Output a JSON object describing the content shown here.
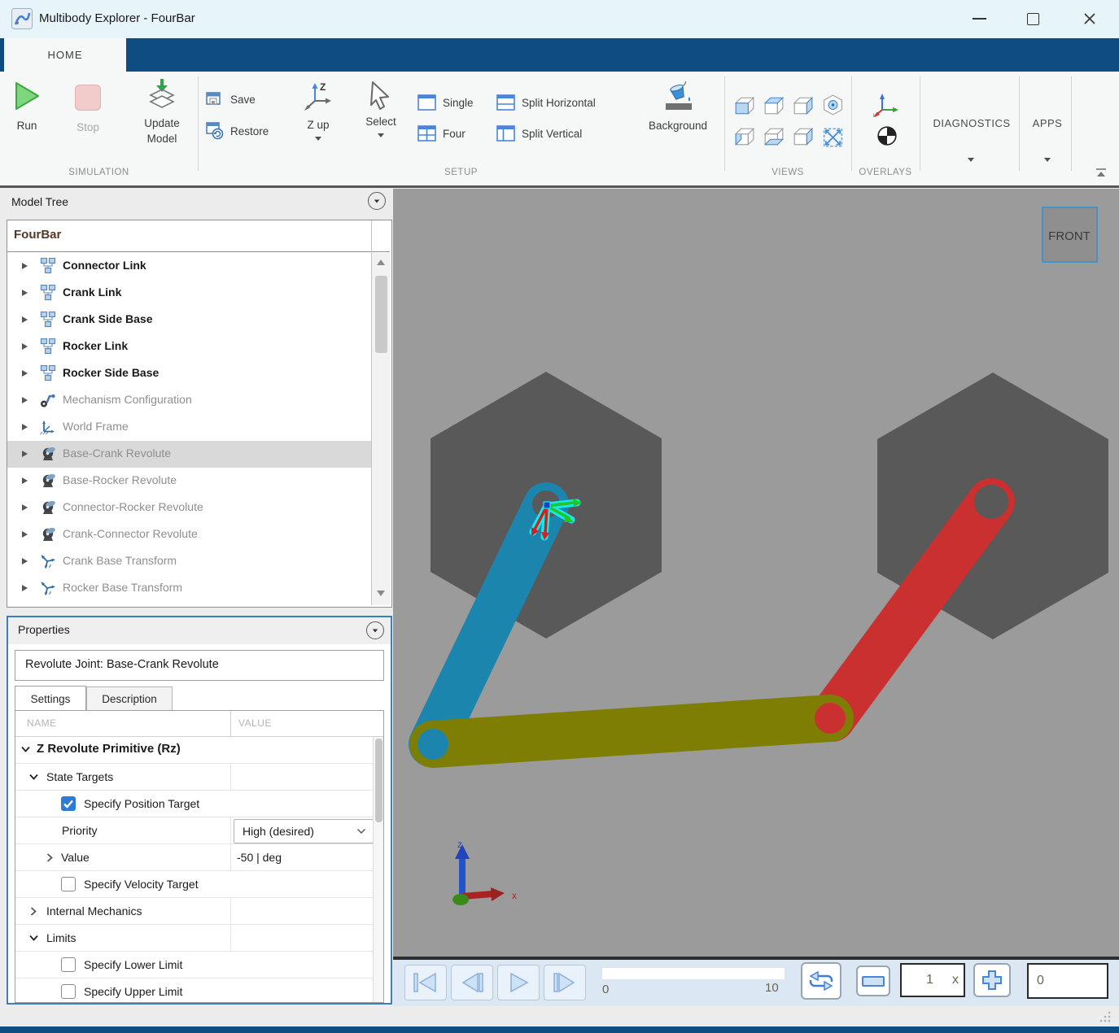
{
  "window": {
    "title": "Multibody Explorer - FourBar"
  },
  "ribbon": {
    "home_tab": "HOME",
    "run": "Run",
    "stop": "Stop",
    "update_model_line1": "Update",
    "update_model_line2": "Model",
    "simulation_section": "SIMULATION",
    "save": "Save",
    "restore": "Restore",
    "z_up": "Z up",
    "select": "Select",
    "single": "Single",
    "four": "Four",
    "split_horizontal": "Split Horizontal",
    "split_vertical": "Split Vertical",
    "background": "Background",
    "setup_section": "SETUP",
    "views_section": "VIEWS",
    "overlays_section": "OVERLAYS",
    "diagnostics": "DIAGNOSTICS",
    "apps": "APPS"
  },
  "model_tree": {
    "header": "Model Tree",
    "root": "FourBar",
    "items": [
      {
        "label": "Connector Link",
        "icon": "subsystem-icon"
      },
      {
        "label": "Crank Link",
        "icon": "subsystem-icon"
      },
      {
        "label": "Crank Side Base",
        "icon": "subsystem-icon"
      },
      {
        "label": "Rocker Link",
        "icon": "subsystem-icon"
      },
      {
        "label": "Rocker Side Base",
        "icon": "subsystem-icon"
      },
      {
        "label": "Mechanism Configuration",
        "icon": "mechanism-config-icon"
      },
      {
        "label": "World Frame",
        "icon": "world-frame-icon"
      },
      {
        "label": "Base-Crank Revolute",
        "icon": "revolute-joint-icon",
        "selected": true
      },
      {
        "label": "Base-Rocker Revolute",
        "icon": "revolute-joint-icon"
      },
      {
        "label": "Connector-Rocker Revolute",
        "icon": "revolute-joint-icon"
      },
      {
        "label": "Crank-Connector Revolute",
        "icon": "revolute-joint-icon"
      },
      {
        "label": "Crank Base Transform",
        "icon": "transform-icon"
      },
      {
        "label": "Rocker Base Transform",
        "icon": "transform-icon"
      }
    ]
  },
  "properties": {
    "header": "Properties",
    "selection_title": "Revolute Joint: Base-Crank Revolute",
    "tabs": {
      "settings": "Settings",
      "description": "Description"
    },
    "columns": {
      "name": "NAME",
      "value": "VALUE"
    },
    "rows": {
      "primitive": "Z Revolute Primitive (Rz)",
      "state_targets": "State Targets",
      "specify_position_target": {
        "label": "Specify Position Target",
        "checked": true
      },
      "priority": {
        "label": "Priority",
        "value": "High (desired)"
      },
      "value": {
        "label": "Value",
        "value": "-50 | deg"
      },
      "specify_velocity_target": {
        "label": "Specify Velocity Target",
        "checked": false
      },
      "internal_mechanics": "Internal Mechanics",
      "limits": "Limits",
      "specify_lower_limit": {
        "label": "Specify Lower Limit",
        "checked": false
      },
      "specify_upper_limit": {
        "label": "Specify Upper Limit",
        "checked": false
      }
    }
  },
  "viewport": {
    "view_cube_label": "FRONT",
    "triad": {
      "up": "z",
      "right": "x"
    }
  },
  "playback": {
    "slider_start": "0",
    "slider_end": "10",
    "speed_value": "1",
    "speed_unit": "x",
    "time_value": "0"
  },
  "colors": {
    "accent-navy": "#0f4c81",
    "viewport-bg": "#9b9b9b",
    "hexagon-gray": "#595959",
    "crank-blue": "#1b85ad",
    "rocker-red": "#c9302f",
    "coupler-olive": "#7e7e04",
    "selection-gray": "#d9d9d9",
    "checkbox-blue": "#2e7bd6",
    "run-green": "#7ed67e",
    "stop-pink": "#f2cbcb"
  }
}
